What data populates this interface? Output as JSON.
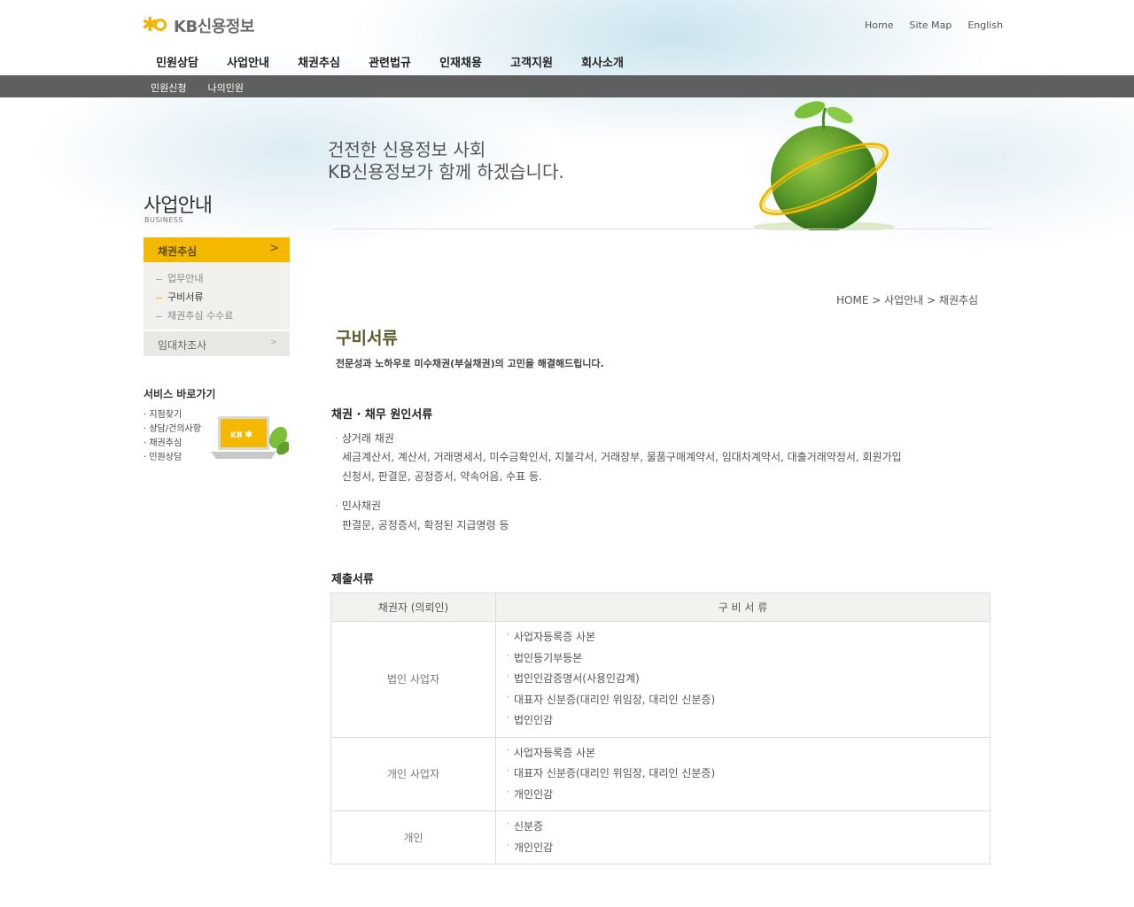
{
  "header": {
    "logo_text": "KB신용정보",
    "util_links": [
      "Home",
      "Site Map",
      "English"
    ],
    "gnb": [
      "민원상담",
      "사업안내",
      "채권추심",
      "관련법규",
      "인재채용",
      "고객지원",
      "회사소개"
    ],
    "sub_menu": [
      "민원신청",
      "나의민원"
    ]
  },
  "banner": {
    "slogan_line1": "건전한 신용정보 사회",
    "slogan_line2": "KB신용정보가 함께 하겠습니다."
  },
  "sidebar": {
    "title": "사업안내",
    "subtitle": "BUSINESS",
    "active_item": "채권추심",
    "active_arrow": ">",
    "sub_items": [
      {
        "label": "업무안내",
        "active": false
      },
      {
        "label": "구비서류",
        "active": true
      },
      {
        "label": "채권추심 수수료",
        "active": false
      }
    ],
    "other_item": "임대차조사",
    "other_arrow": ">",
    "service_title": "서비스 바로가기",
    "service_links": [
      "· 지점찾기",
      "· 상담/건의사항",
      "· 채권추심",
      "· 민원상담"
    ]
  },
  "main": {
    "breadcrumb": "HOME > 사업안내 > 채권추심",
    "title": "구비서류",
    "description": "전문성과 노하우로 미수채권(부실채권)의 고민을 해결해드립니다.",
    "section1_title": "채권 · 채무 원인서류",
    "bullet1": "상거래 채권",
    "para1_line1": "세금계산서, 계산서, 거래명세서, 미수금확인서, 지불각서, 거래장부, 물품구매계약서, 임대차계약서, 대출거래약정서, 회원가입",
    "para1_line2": "신청서, 판결문, 공정증서, 약속어음, 수표 등.",
    "bullet2": "민사채권",
    "para2": "판결문, 공정증서, 확정된 지급명령 등",
    "section2_title": "제출서류",
    "table": {
      "headers": [
        "채권자 (의뢰인)",
        "구 비 서 류"
      ],
      "rows": [
        {
          "who": "법인 사업자",
          "docs": [
            "사업자등록증 사본",
            "법인등기부등본",
            "법인인감증명서(사용인감계)",
            "대표자 신분증(대리인 위임장, 대리인 신분증)",
            "법인인감"
          ]
        },
        {
          "who": "개인 사업자",
          "docs": [
            "사업자등록증 사본",
            "대표자 신분증(대리인 위임장, 대리인 신분증)",
            "개인인감"
          ]
        },
        {
          "who": "개인",
          "docs": [
            "신분증",
            "개인인감"
          ]
        }
      ]
    }
  }
}
